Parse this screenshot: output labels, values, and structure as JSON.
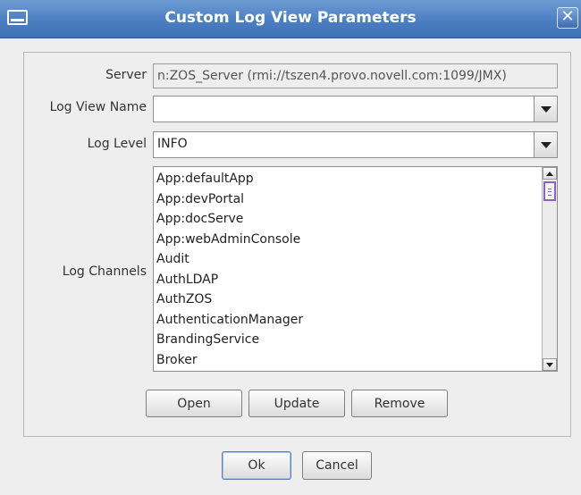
{
  "window": {
    "title": "Custom Log View Parameters",
    "close_glyph": "✕"
  },
  "form": {
    "server_label": "Server",
    "server_value": "n:ZOS_Server (rmi://tszen4.provo.novell.com:1099/JMX)",
    "log_view_name_label": "Log View Name",
    "log_view_name_value": "",
    "log_level_label": "Log Level",
    "log_level_value": "INFO",
    "log_channels_label": "Log Channels"
  },
  "channels": [
    "App:defaultApp",
    "App:devPortal",
    "App:docServe",
    "App:webAdminConsole",
    "Audit",
    "AuthLDAP",
    "AuthZOS",
    "AuthenticationManager",
    "BrandingService",
    "Broker"
  ],
  "actions": {
    "open_label": "Open",
    "update_label": "Update",
    "remove_label": "Remove"
  },
  "dialog_buttons": {
    "ok_label": "Ok",
    "cancel_label": "Cancel"
  },
  "colors": {
    "titlebar": "#4b7fc2",
    "focus_accent": "#8a63c8"
  }
}
